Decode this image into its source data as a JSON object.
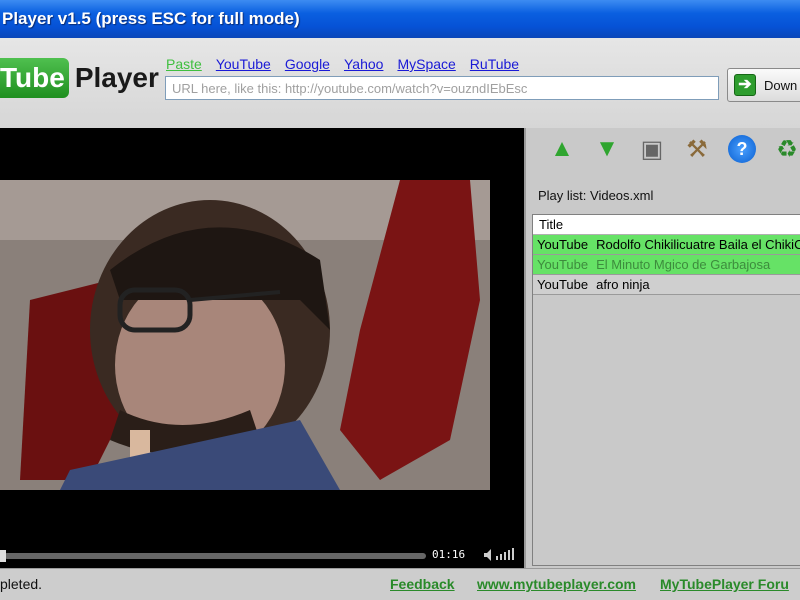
{
  "window": {
    "title": "Player v1.5 (press ESC for full mode)"
  },
  "header": {
    "logo_tube": "Tube",
    "logo_player": "Player",
    "links": [
      "Paste",
      "YouTube",
      "Google",
      "Yahoo",
      "MySpace",
      "RuTube"
    ],
    "url_placeholder": "URL here, like this: http://youtube.com/watch?v=ouzndIEbEsc",
    "download_label": "Down"
  },
  "video": {
    "time": "01:16",
    "progress": 0.0
  },
  "toolbar": {
    "icons": [
      "arrow-up-icon",
      "arrow-down-icon",
      "save-icon",
      "tools-icon",
      "help-icon",
      "recycle-icon"
    ],
    "help_glyph": "?"
  },
  "playlist": {
    "label": "Play list: Videos.xml",
    "header": "Title",
    "rows": [
      {
        "source": "YouTube",
        "title": "Rodolfo Chikilicuatre Baila el ChikiC"
      },
      {
        "source": "YouTube",
        "title": "El Minuto Mgico de Garbajosa"
      },
      {
        "source": "YouTube",
        "title": "afro ninja"
      }
    ]
  },
  "status": {
    "text": "pleted.",
    "links": [
      "Feedback",
      "www.mytubeplayer.com",
      "MyTubePlayer Foru"
    ]
  },
  "colors": {
    "titlebar": "#0652d6",
    "accent_green": "#3fbf3f",
    "row_highlight": "#66e266",
    "link_blue": "#1a1ad6"
  }
}
